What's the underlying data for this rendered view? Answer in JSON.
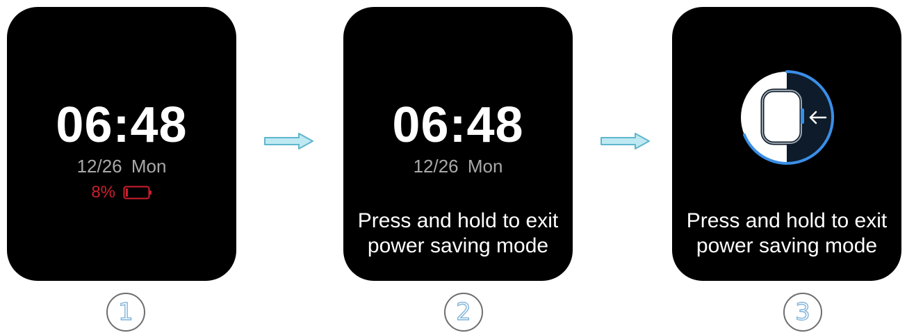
{
  "colors": {
    "screen_bg": "#000000",
    "text_primary": "#ffffff",
    "text_secondary": "#a9a9a9",
    "battery_low": "#cc1f2e",
    "accent_blue": "#3a8ee6",
    "arrow_fill": "#bfe9f2",
    "arrow_stroke": "#5fb6cc",
    "step_outline": "#6e6e6e",
    "step_number": "#7fb3d9"
  },
  "screens": [
    {
      "time": "06:48",
      "date": "12/26  Mon",
      "battery_text": "8%",
      "battery_level": 0.08,
      "icons": [
        "battery-low-icon"
      ]
    },
    {
      "time": "06:48",
      "date": "12/26  Mon",
      "hint_line1": "Press and hold to exit",
      "hint_line2": "power saving mode"
    },
    {
      "hint_line1": "Press and hold to exit",
      "hint_line2": "power saving mode",
      "icons": [
        "watch-exit-icon",
        "arrow-left-icon"
      ]
    }
  ],
  "flow_arrows": [
    "right-arrow-icon",
    "right-arrow-icon"
  ],
  "steps": [
    "1",
    "2",
    "3"
  ]
}
